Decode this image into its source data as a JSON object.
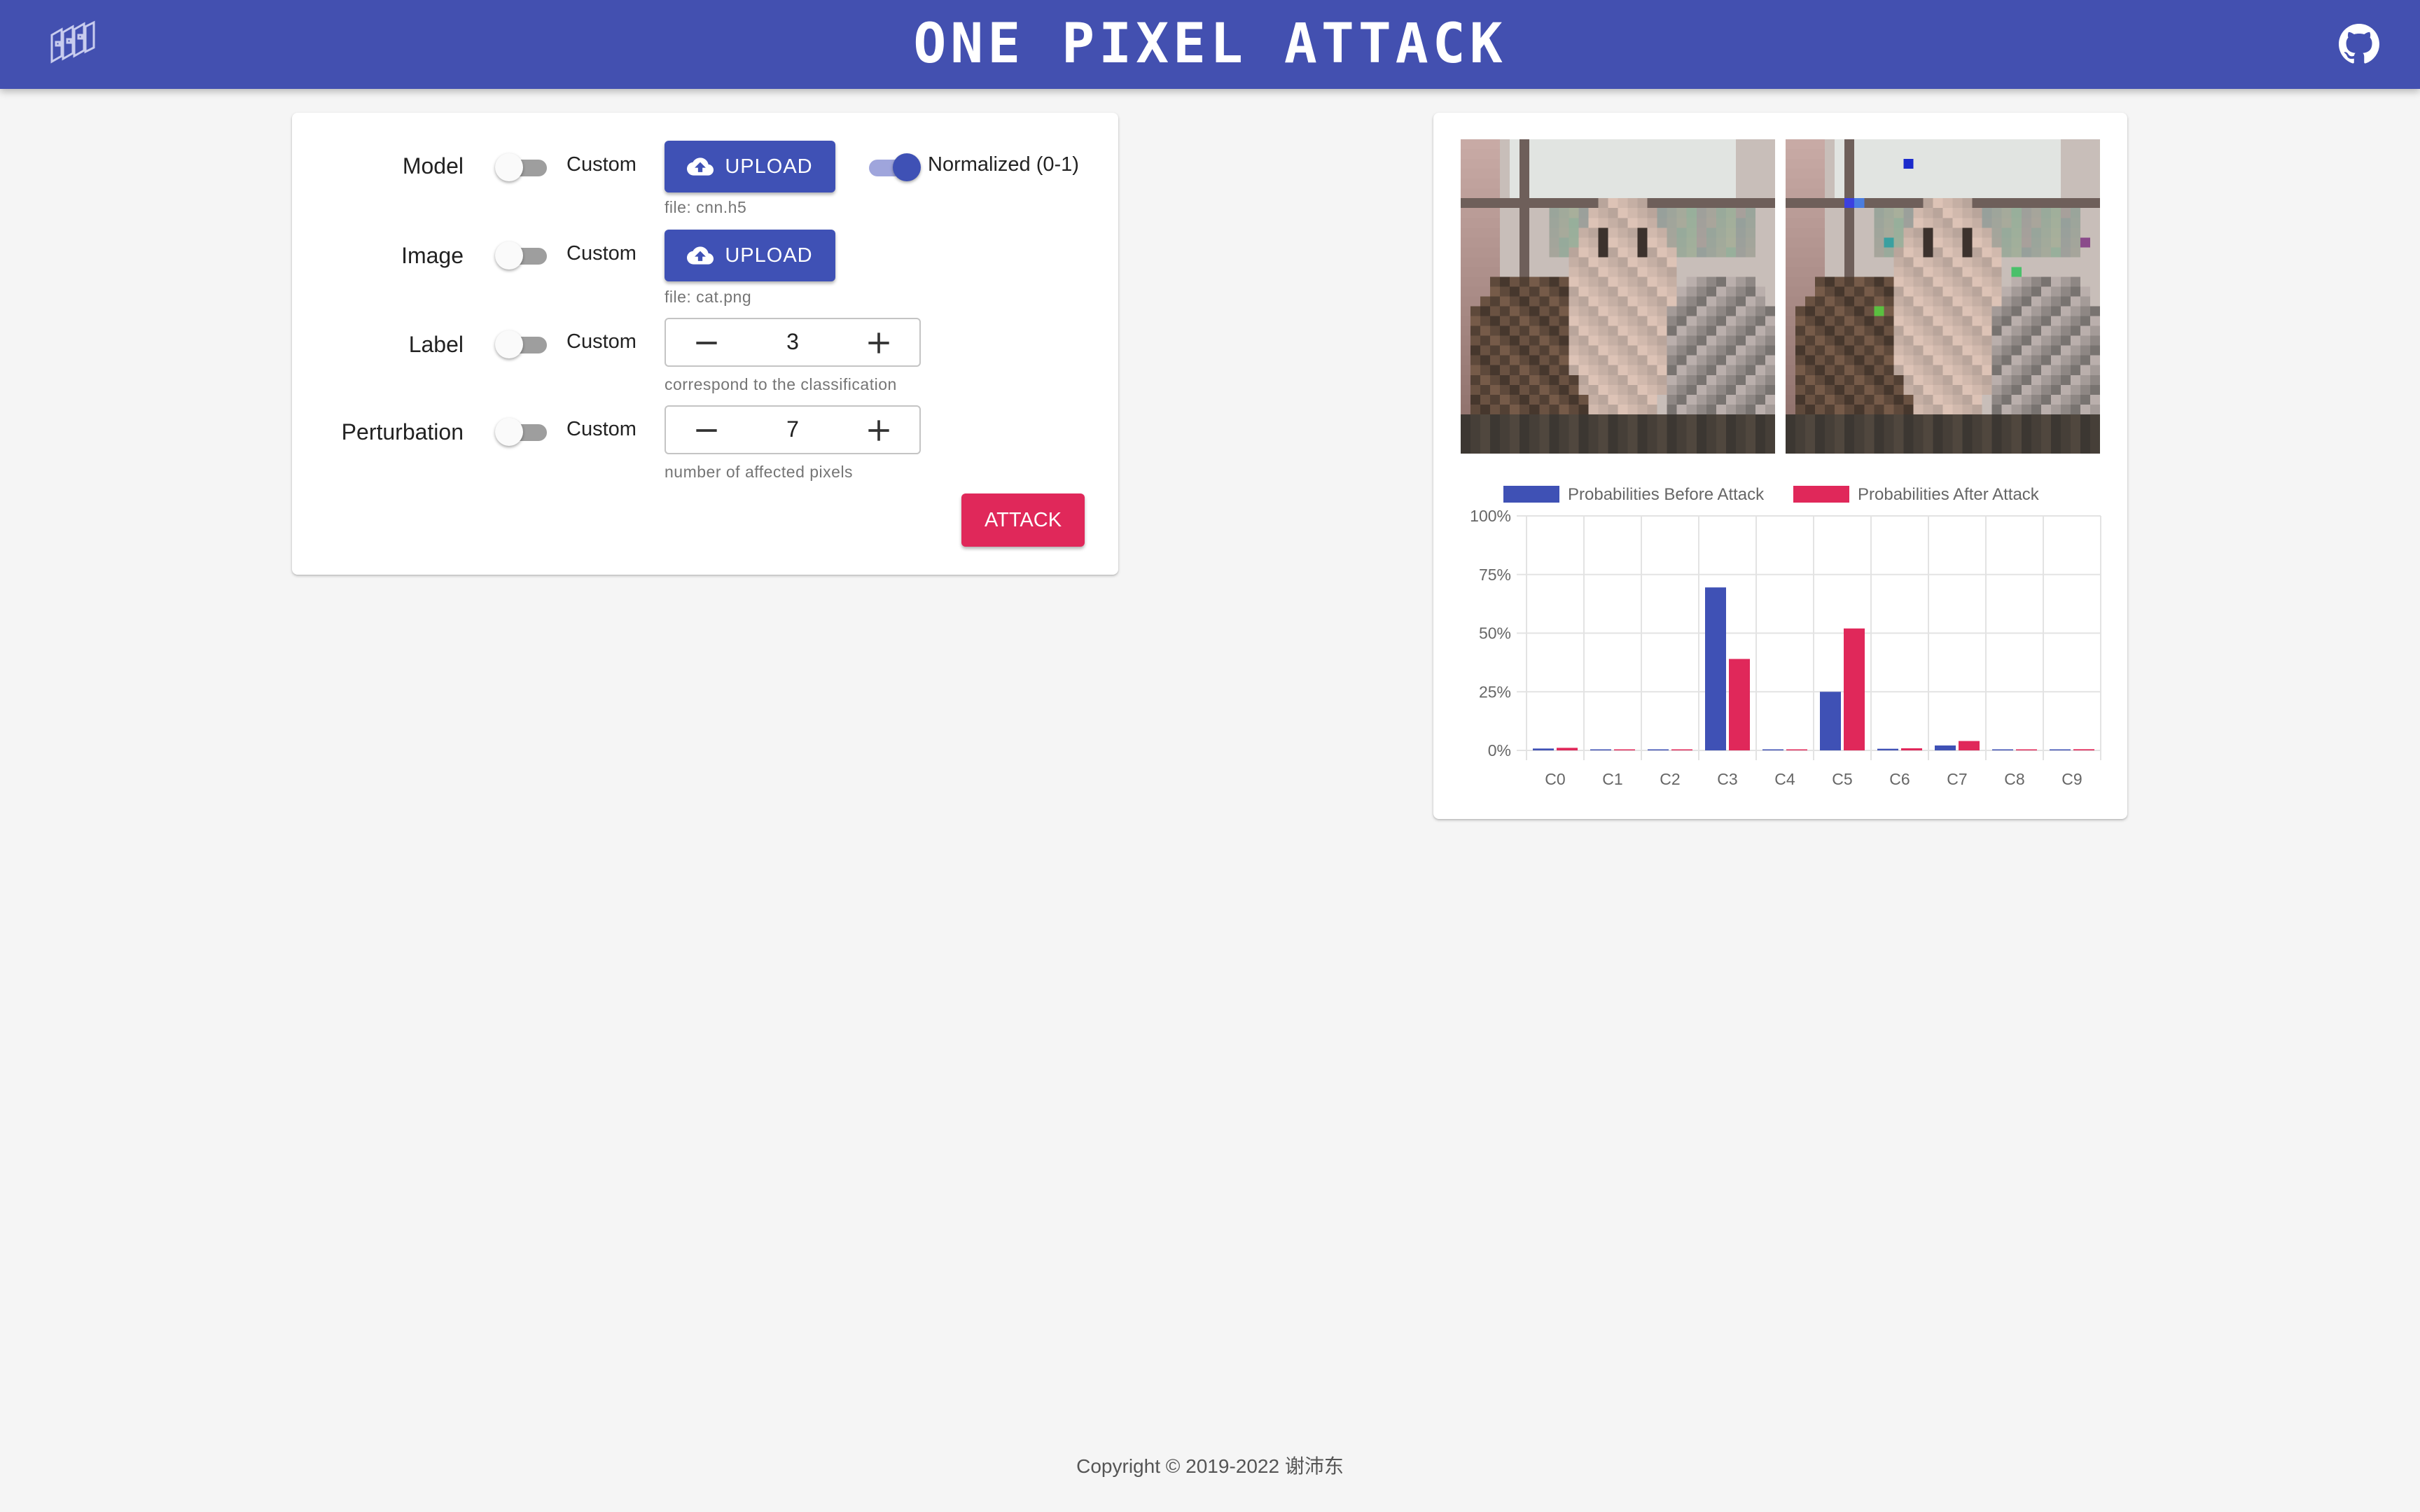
{
  "header": {
    "title": "ONE PIXEL ATTACK"
  },
  "form": {
    "rows": [
      {
        "label": "Model",
        "custom_label": "Custom",
        "custom_on": false
      },
      {
        "label": "Image",
        "custom_label": "Custom",
        "custom_on": false
      },
      {
        "label": "Label",
        "custom_label": "Custom",
        "custom_on": false
      },
      {
        "label": "Perturbation",
        "custom_label": "Custom",
        "custom_on": false
      }
    ],
    "model_upload_label": "UPLOAD",
    "model_file": "file: cnn.h5",
    "normalized_label": "Normalized (0-1)",
    "normalized_on": true,
    "image_upload_label": "UPLOAD",
    "image_file": "file: cat.png",
    "label_value": "3",
    "label_helper": "correspond to the classification",
    "perturbation_value": "7",
    "perturbation_helper": "number of affected pixels",
    "attack_label": "ATTACK"
  },
  "colors": {
    "primary": "#3f51b5",
    "secondary": "#e0285a",
    "header": "#4350b0"
  },
  "chart_data": {
    "type": "bar",
    "categories": [
      "C0",
      "C1",
      "C2",
      "C3",
      "C4",
      "C5",
      "C6",
      "C7",
      "C8",
      "C9"
    ],
    "series": [
      {
        "name": "Probabilities Before Attack",
        "color": "#3f51b5",
        "values": [
          0.8,
          0.2,
          0.1,
          69.5,
          0.1,
          25.0,
          0.7,
          2.1,
          0.1,
          0.1
        ]
      },
      {
        "name": "Probabilities After Attack",
        "color": "#e0285a",
        "values": [
          1.1,
          0.3,
          0.3,
          39.0,
          0.1,
          52.0,
          0.9,
          4.0,
          0.3,
          0.5
        ]
      }
    ],
    "yticks": [
      "0%",
      "25%",
      "50%",
      "75%",
      "100%"
    ],
    "ylim": [
      0,
      100
    ],
    "legend_position": "top",
    "grid": true
  },
  "footer": {
    "copyright": "Copyright © 2019-2022 谢沛东"
  }
}
